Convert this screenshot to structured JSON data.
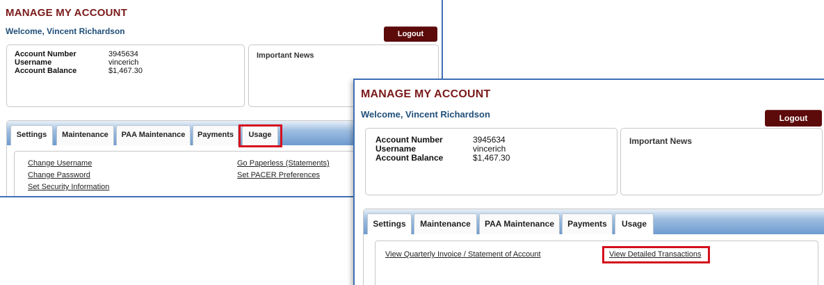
{
  "screen1": {
    "title": "MANAGE MY ACCOUNT",
    "welcome": "Welcome, Vincent Richardson",
    "logout": "Logout",
    "account": {
      "number_label": "Account Number",
      "number_value": "3945634",
      "username_label": "Username",
      "username_value": "vincerich",
      "balance_label": "Account Balance",
      "balance_value": "$1,467.30"
    },
    "news_title": "Important News",
    "tabs": [
      "Settings",
      "Maintenance",
      "PAA Maintenance",
      "Payments",
      "Usage"
    ],
    "links": {
      "change_username": "Change Username",
      "change_password": "Change Password",
      "set_security": "Set Security Information",
      "go_paperless": "Go Paperless (Statements)",
      "pacer_prefs": "Set PACER Preferences"
    }
  },
  "screen2": {
    "title": "MANAGE MY ACCOUNT",
    "welcome": "Welcome, Vincent Richardson",
    "logout": "Logout",
    "account": {
      "number_label": "Account Number",
      "number_value": "3945634",
      "username_label": "Username",
      "username_value": "vincerich",
      "balance_label": "Account Balance",
      "balance_value": "$1,467.30"
    },
    "news_title": "Important News",
    "tabs": [
      "Settings",
      "Maintenance",
      "PAA Maintenance",
      "Payments",
      "Usage"
    ],
    "links": {
      "quarterly_invoice": "View Quarterly Invoice / Statement of Account",
      "detailed_transactions": "View Detailed Transactions"
    }
  },
  "colors": {
    "title": "#7a1a1a",
    "welcome": "#1f4e79",
    "logout_bg": "#5c0a0a",
    "highlight": "#d4101d",
    "tabbar": "#6e9bd0"
  }
}
